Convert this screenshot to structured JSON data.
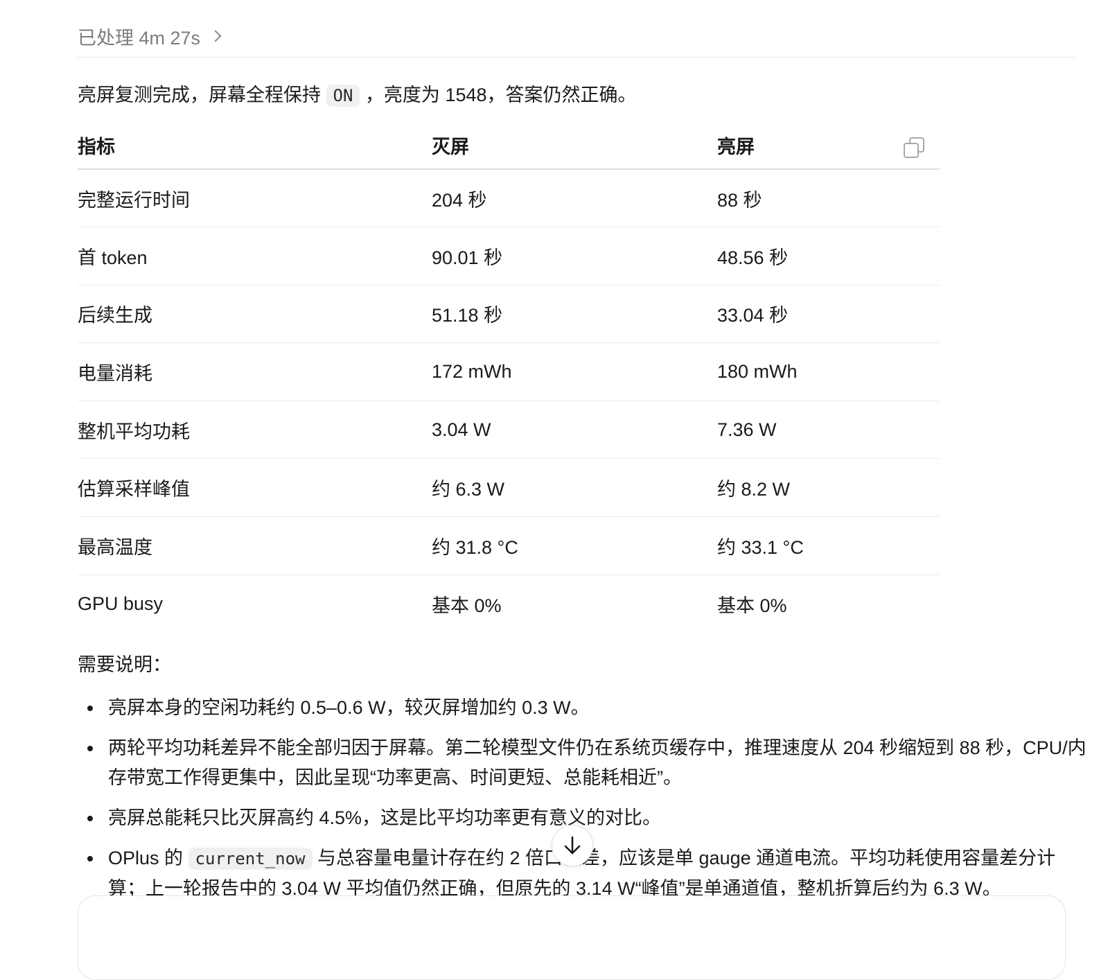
{
  "processing": {
    "label": "已处理 4m 27s"
  },
  "summary": {
    "before_code": "亮屏复测完成，屏幕全程保持",
    "code": "ON",
    "after_code": "，亮度为 1548，答案仍然正确。"
  },
  "table": {
    "headers": [
      "指标",
      "灭屏",
      "亮屏"
    ],
    "rows": [
      [
        "完整运行时间",
        "204 秒",
        "88 秒"
      ],
      [
        "首 token",
        "90.01 秒",
        "48.56 秒"
      ],
      [
        "后续生成",
        "51.18 秒",
        "33.04 秒"
      ],
      [
        "电量消耗",
        "172 mWh",
        "180 mWh"
      ],
      [
        "整机平均功耗",
        "3.04 W",
        "7.36 W"
      ],
      [
        "估算采样峰值",
        "约 6.3 W",
        "约 8.2 W"
      ],
      [
        "最高温度",
        "约 31.8 °C",
        "约 33.1 °C"
      ],
      [
        "GPU busy",
        "基本 0%",
        "基本 0%"
      ]
    ]
  },
  "notes": {
    "title": "需要说明：",
    "items": [
      "亮屏本身的空闲功耗约 0.5–0.6 W，较灭屏增加约 0.3 W。",
      "两轮平均功耗差异不能全部归因于屏幕。第二轮模型文件仍在系统页缓存中，推理速度从 204 秒缩短到 88 秒，CPU/内存带宽工作得更集中，因此呈现“功率更高、时间更短、总能耗相近”。",
      "亮屏总能耗只比灭屏高约 4.5%，这是比平均功率更有意义的对比。",
      {
        "before_code": "OPlus 的",
        "code": "current_now",
        "after_code": "与总容量电量计存在约 2 倍口径差，应该是单 gauge 通道电流。平均功耗使用容量差分计算；上一轮报告中的 3.04 W 平均值仍然正确，但原先的 3.14 W“峰值”是单通道值，整机折算后约为 6.3 W。"
      }
    ]
  },
  "icons": {
    "chevron": "chevron-right-icon",
    "copy": "copy-icon",
    "scroll_down": "arrow-down-icon"
  }
}
